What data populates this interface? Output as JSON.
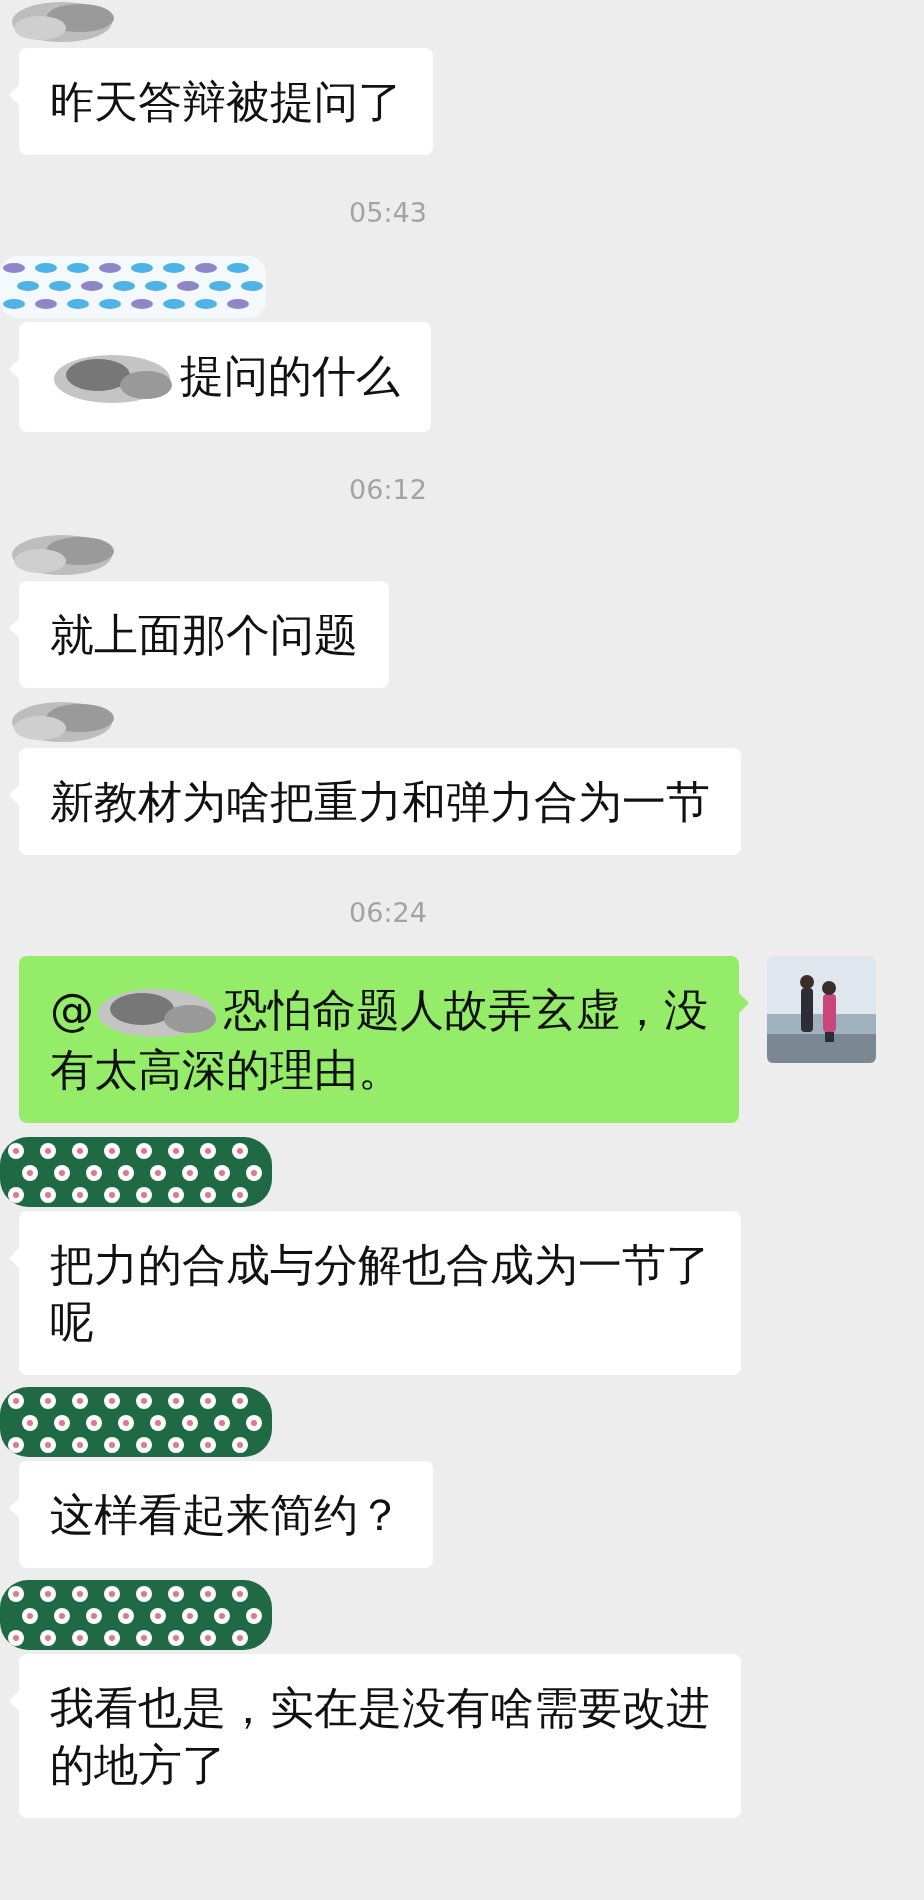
{
  "messages": [
    {
      "kind": "incoming",
      "name_cover": {
        "kind": "scribble"
      },
      "segments": [
        {
          "kind": "text",
          "text": "昨天答辩被提问了"
        }
      ]
    },
    {
      "kind": "time",
      "text": "05:43"
    },
    {
      "kind": "incoming",
      "name_cover": {
        "kind": "fish"
      },
      "segments": [
        {
          "kind": "cover"
        },
        {
          "kind": "text",
          "text": "提问的什么"
        }
      ]
    },
    {
      "kind": "time",
      "text": "06:12"
    },
    {
      "kind": "incoming",
      "name_cover": {
        "kind": "scribble"
      },
      "segments": [
        {
          "kind": "text",
          "text": "就上面那个问题"
        }
      ]
    },
    {
      "kind": "incoming",
      "name_cover": {
        "kind": "scribble"
      },
      "segments": [
        {
          "kind": "text",
          "text": "新教材为啥把重力和弹力合为一节"
        }
      ]
    },
    {
      "kind": "time",
      "text": "06:24"
    },
    {
      "kind": "outgoing",
      "segments": [
        {
          "kind": "text",
          "text": "@"
        },
        {
          "kind": "cover"
        },
        {
          "kind": "text",
          "text": "恐怕命题人故弄玄虚，没"
        },
        {
          "kind": "break"
        },
        {
          "kind": "text",
          "text": "有太高深的理由。"
        }
      ]
    },
    {
      "kind": "incoming",
      "name_cover": {
        "kind": "flowers"
      },
      "segments": [
        {
          "kind": "text",
          "text": "把力的合成与分解也合成为一节了"
        },
        {
          "kind": "break"
        },
        {
          "kind": "text",
          "text": "呢"
        }
      ]
    },
    {
      "kind": "incoming",
      "name_cover": {
        "kind": "flowers"
      },
      "segments": [
        {
          "kind": "text",
          "text": "这样看起来简约？"
        }
      ]
    },
    {
      "kind": "incoming",
      "name_cover": {
        "kind": "flowers"
      },
      "segments": [
        {
          "kind": "text",
          "text": "我看也是，实在是没有啥需要改进"
        },
        {
          "kind": "break"
        },
        {
          "kind": "text",
          "text": "的地方了"
        }
      ]
    }
  ]
}
